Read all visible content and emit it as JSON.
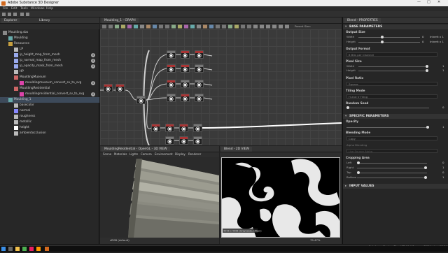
{
  "window": {
    "title": "Adobe Substance 3D Designer",
    "controls": [
      "—",
      "□",
      "✕"
    ]
  },
  "menu": [
    "File",
    "Edit",
    "Tools",
    "Windows",
    "Help"
  ],
  "explorer": {
    "tabs": [
      "Explorer",
      "Library"
    ],
    "items": [
      {
        "label": "Moulding.sbs",
        "indent": 0,
        "icon": "package-icon",
        "color": "#888"
      },
      {
        "label": "Moulding",
        "indent": 1,
        "icon": "graph-icon",
        "color": "#6aa"
      },
      {
        "label": "Resources",
        "indent": 1,
        "icon": "folder-icon",
        "color": "#c8a040"
      },
      {
        "label": "LP",
        "indent": 2,
        "icon": "mesh-icon",
        "color": "#bbb"
      },
      {
        "label": "ip_height_map_from_mesh",
        "indent": 2,
        "icon": "bake-icon",
        "color": "#9ae",
        "info": true
      },
      {
        "label": "ip_normal_map_from_mesh",
        "indent": 2,
        "icon": "bake-icon",
        "color": "#9ae",
        "info": true
      },
      {
        "label": "ip_opacity_mask_from_mesh",
        "indent": 2,
        "icon": "bake-icon",
        "color": "#9ae",
        "info": true
      },
      {
        "label": "HP",
        "indent": 2,
        "icon": "mesh-icon",
        "color": "#bbb"
      },
      {
        "label": "MouldingMuseum",
        "indent": 2,
        "icon": "graph-icon",
        "color": "#c66"
      },
      {
        "label": "mouldingmuseum_convert_sv_to_svg",
        "indent": 3,
        "icon": "svg-icon",
        "color": "#d4a",
        "info": true
      },
      {
        "label": "MouldingResidential",
        "indent": 2,
        "icon": "graph-icon",
        "color": "#c66"
      },
      {
        "label": "mouldingresidential_convert_sv_to_svg",
        "indent": 3,
        "icon": "svg-icon",
        "color": "#d4a",
        "info": true
      },
      {
        "label": "Moulding_1",
        "indent": 1,
        "icon": "graph-icon",
        "color": "#6aa",
        "selected": true
      },
      {
        "label": "basecolor",
        "indent": 2,
        "icon": "output-icon",
        "color": "#bbb"
      },
      {
        "label": "normal",
        "indent": 2,
        "icon": "output-icon",
        "color": "#88f"
      },
      {
        "label": "roughness",
        "indent": 2,
        "icon": "output-icon",
        "color": "#bbb"
      },
      {
        "label": "metallic",
        "indent": 2,
        "icon": "output-icon",
        "color": "#bbb"
      },
      {
        "label": "height",
        "indent": 2,
        "icon": "output-icon",
        "color": "#fff"
      },
      {
        "label": "ambientocclusion",
        "indent": 2,
        "icon": "output-icon",
        "color": "#bbb"
      }
    ]
  },
  "graph": {
    "title": "Moulding_1 - GRAPH",
    "parent_label": "Parent Size:"
  },
  "view3d": {
    "title": "MouldingResidential - OpenGL - 3D VIEW",
    "menus": [
      "Scene",
      "Materials",
      "Lights",
      "Camera",
      "Environment",
      "Display",
      "Renderer"
    ],
    "footer": "sRGB (default)"
  },
  "view2d": {
    "title": "Blend - 2D VIEW",
    "caption": "4096 x 4096 (Grayscale, 16bpc)",
    "zoom": "79.47%"
  },
  "props": {
    "title": "Blend - PROPERTIES",
    "base_section": "BASE PARAMETERS",
    "output_size": "Output Size",
    "width_label": "Width",
    "height_label": "Height",
    "width_val": "0",
    "height_val": "0",
    "width_rel": "Inherit x 1",
    "height_rel": "Inherit x 1",
    "output_format": "Output Format",
    "format_val": "8 Bits per Channel",
    "pixel_size": "Pixel Size",
    "px_width_val": "1",
    "px_height_val": "1",
    "pixel_ratio": "Pixel Ratio",
    "ratio_val": "Square",
    "tiling_mode": "Tiling Mode",
    "tiling_val": "H and V Tiling",
    "random_seed": "Random Seed",
    "seed_val": "0",
    "specific_section": "SPECIFIC PARAMETERS",
    "opacity": "Opacity",
    "opacity_val": "1",
    "blending_mode": "Blending Mode",
    "blend_val": "Copy",
    "alpha_blending": "Alpha Blending",
    "alpha_val": "Use Source Alpha",
    "cropping": "Cropping Area",
    "crop_left": "Left",
    "crop_left_val": "0",
    "crop_right": "Right",
    "crop_right_val": "1",
    "crop_top": "Top",
    "crop_top_val": "0",
    "crop_bottom": "Bottom",
    "crop_bottom_val": "1",
    "input_section": "INPUT VALUES"
  },
  "status": {
    "engine": "Substance Engine: Direct3D 11 | Memory: 12%",
    "version": "Version: 13.0.1"
  }
}
